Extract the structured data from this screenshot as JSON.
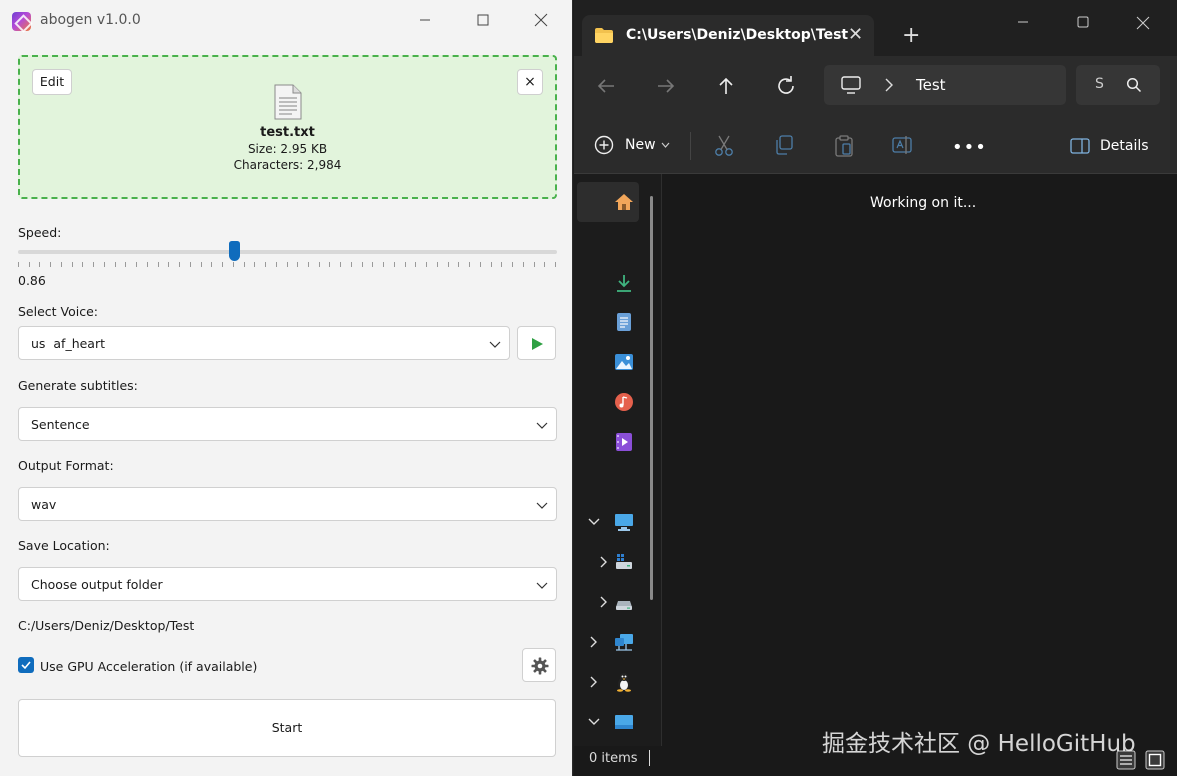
{
  "abogen": {
    "title": "abogen v1.0.0",
    "dropzone": {
      "edit_label": "Edit",
      "close_label": "×",
      "file_name": "test.txt",
      "file_size": "Size: 2.95 KB",
      "file_chars": "Characters: 2,984"
    },
    "speed": {
      "label": "Speed:",
      "value_text": "0.86",
      "fraction": 0.4
    },
    "voice": {
      "label": "Select Voice:",
      "selected": "us  af_heart"
    },
    "subtitles": {
      "label": "Generate subtitles:",
      "selected": "Sentence"
    },
    "format": {
      "label": "Output Format:",
      "selected": "wav"
    },
    "save": {
      "label": "Save Location:",
      "selected": "Choose output folder",
      "path": "C:/Users/Deniz/Desktop/Test"
    },
    "gpu": {
      "label": "Use GPU Acceleration (if available)",
      "checked": true
    },
    "start_label": "Start",
    "accent": "#0f6cbd",
    "dropzone_color": "#e2f4dc"
  },
  "explorer": {
    "tab_title": "C:\\Users\\Deniz\\Desktop\\Test",
    "tab_close": "✕",
    "new_tab": "+",
    "breadcrumb": "Test",
    "search_text": "S",
    "toolbar": {
      "new_label": "New",
      "more": "•••",
      "details_label": "Details"
    },
    "status_message": "Working on it...",
    "items_count": "0 items"
  },
  "watermark": "掘金技术社区 @ HelloGitHub"
}
